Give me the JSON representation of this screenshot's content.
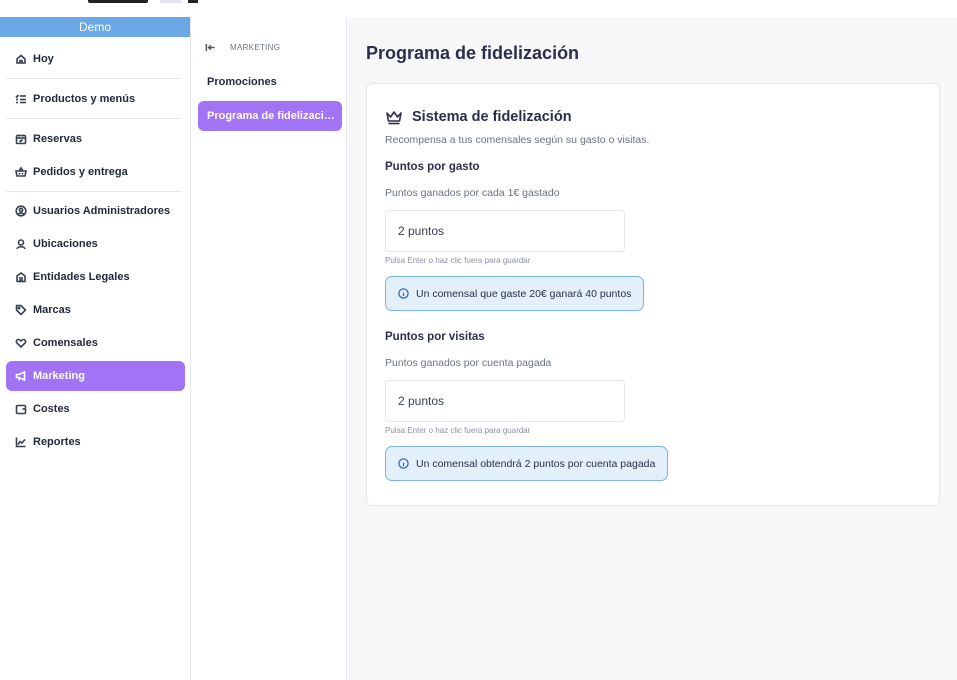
{
  "sidebar": {
    "workspace": "Demo",
    "items": [
      {
        "label": "Hoy",
        "icon": "home-icon"
      },
      {
        "label": "Productos y menús",
        "icon": "list-check-icon"
      },
      {
        "label": "Reservas",
        "icon": "calendar-icon"
      },
      {
        "label": "Pedidos y entrega",
        "icon": "basket-icon"
      },
      {
        "label": "Usuarios Administradores",
        "icon": "user-circle-icon"
      },
      {
        "label": "Ubicaciones",
        "icon": "location-user-icon"
      },
      {
        "label": "Entidades Legales",
        "icon": "building-icon"
      },
      {
        "label": "Marcas",
        "icon": "tag-icon"
      },
      {
        "label": "Comensales",
        "icon": "heart-hand-icon"
      },
      {
        "label": "Marketing",
        "icon": "megaphone-icon",
        "active": true
      },
      {
        "label": "Costes",
        "icon": "wallet-icon"
      },
      {
        "label": "Reportes",
        "icon": "chart-icon"
      }
    ]
  },
  "subnav": {
    "section": "MARKETING",
    "items": [
      {
        "label": "Promociones"
      },
      {
        "label": "Programa de fidelización",
        "active": true
      }
    ]
  },
  "main": {
    "title": "Programa de fidelización",
    "card": {
      "title": "Sistema de fidelización",
      "subtitle": "Recompensa a tus comensales según su gasto o visitas.",
      "spend": {
        "title": "Puntos por gasto",
        "description": "Puntos ganados por cada 1€ gastado",
        "value": "2 puntos",
        "hint": "Pulsa Enter o haz clic fuera para guardar",
        "info": "Un comensal que gaste 20€ ganará 40 puntos"
      },
      "visits": {
        "title": "Puntos por visitas",
        "description": "Puntos ganados por cuenta pagada",
        "value": "2 puntos",
        "hint": "Pulsa Enter o haz clic fuera para guardar",
        "info": "Un comensal obtendrá 2 puntos por cuenta pagada"
      }
    }
  },
  "colors": {
    "accent": "#a173f5",
    "workspace_bar": "#6aa9e6",
    "info_bg": "#e3eff9",
    "info_border": "#7ab3e8"
  }
}
